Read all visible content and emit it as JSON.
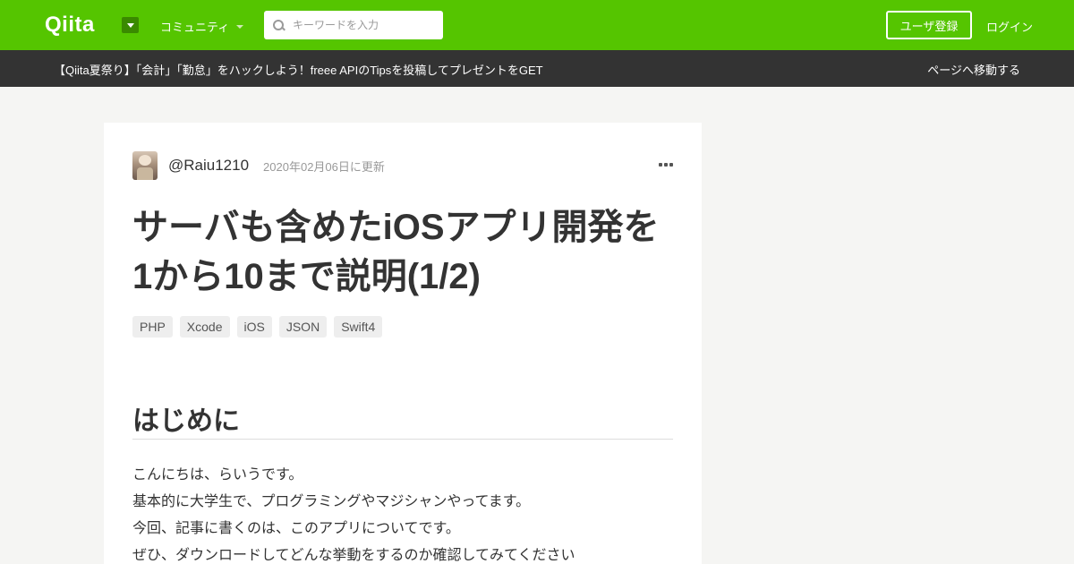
{
  "header": {
    "logo": "Qiita",
    "community_label": "コミュニティ",
    "search_placeholder": "キーワードを入力",
    "signup_label": "ユーザ登録",
    "login_label": "ログイン"
  },
  "banner": {
    "text": "【Qiita夏祭り】「会計」「勤怠」をハックしよう！freee APIのTipsを投稿してプレゼントをGET",
    "link": "ページへ移動する"
  },
  "article": {
    "username": "@Raiu1210",
    "updated": "2020年02月06日に更新",
    "title_line1": "サーバも含めたiOSアプリ開発を",
    "title_line2": "1から10まで説明(1/2)",
    "tags": [
      "PHP",
      "Xcode",
      "iOS",
      "JSON",
      "Swift4"
    ],
    "heading": "はじめに",
    "paragraphs": [
      "こんにちは、らいうです。",
      "基本的に大学生で、プログラミングやマジシャンやってます。",
      "今回、記事に書くのは、このアプリについてです。",
      "ぜひ、ダウンロードしてどんな挙動をするのか確認してみてください"
    ]
  },
  "colors": {
    "brand": "#55c500",
    "banner_bg": "#333333",
    "page_bg": "#f5f5f3"
  }
}
